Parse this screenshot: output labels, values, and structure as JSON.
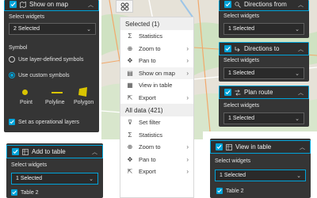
{
  "p1": {
    "title": "Show on map",
    "select_label": "Select widgets",
    "select_value": "2 Selected",
    "symbol_label": "Symbol",
    "radio1": "Use layer-defined symbols",
    "radio2": "Use custom symbols",
    "sym_point": "Point",
    "sym_polyline": "Polyline",
    "sym_polygon": "Polygon",
    "opt_label": "Set as operational layers"
  },
  "p2": {
    "title": "Add to table",
    "select_label": "Select widgets",
    "select_value": "1 Selected",
    "table_item": "Table 2"
  },
  "menu": {
    "selected_header": "Selected (1)",
    "alldata_header": "All data (421)",
    "selected_items": [
      {
        "label": "Statistics",
        "icon": "sigma-icon",
        "sub": false
      },
      {
        "label": "Zoom to",
        "icon": "zoom-icon",
        "sub": true
      },
      {
        "label": "Pan to",
        "icon": "pan-icon",
        "sub": true
      },
      {
        "label": "Show on map",
        "icon": "map-icon",
        "sub": true
      },
      {
        "label": "View in table",
        "icon": "table-icon",
        "sub": false
      },
      {
        "label": "Export",
        "icon": "export-icon",
        "sub": true
      }
    ],
    "all_items": [
      {
        "label": "Set filter",
        "icon": "filter-icon",
        "sub": false
      },
      {
        "label": "Statistics",
        "icon": "sigma-icon",
        "sub": false
      },
      {
        "label": "Zoom to",
        "icon": "zoom-icon",
        "sub": true
      },
      {
        "label": "Pan to",
        "icon": "pan-icon",
        "sub": true
      },
      {
        "label": "Export",
        "icon": "export-icon",
        "sub": true
      }
    ]
  },
  "p3": {
    "title": "Directions from",
    "select_label": "Select widgets",
    "select_value": "1 Selected"
  },
  "p4": {
    "title": "Directions to",
    "select_label": "Select widgets",
    "select_value": "1 Selected"
  },
  "p5": {
    "title": "Plan route",
    "select_label": "Select widgets",
    "select_value": "1 Selected"
  },
  "p6": {
    "title": "View in table",
    "select_label": "Select widgets",
    "select_value": "1 Selected",
    "table_item": "Table 2"
  },
  "colors": {
    "accent": "#00a3d9",
    "panel_bg": "#353535",
    "symbol_yellow": "#d9c400"
  }
}
